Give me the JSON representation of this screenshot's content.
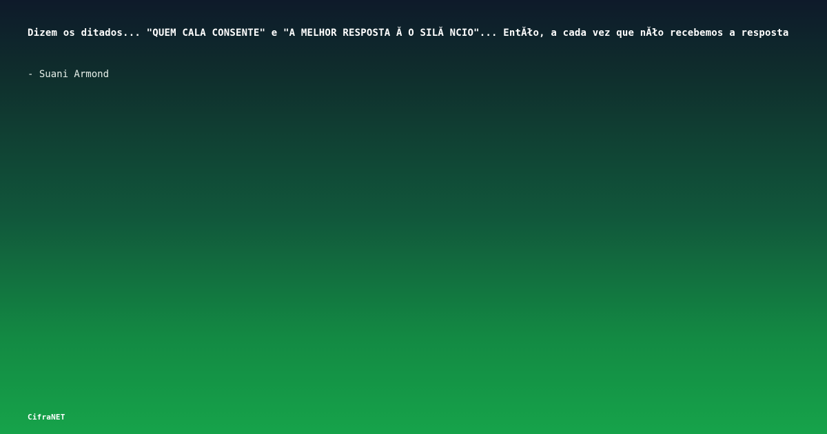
{
  "quote": {
    "text": "Dizem os ditados... \"QUEM CALA CONSENTE\" e \"A MELHOR RESPOSTA Ă  O SILĂ NCIO\"... EntĂło, a cada vez que nĂło recebemos a resposta",
    "author": "- Suani Armond"
  },
  "footer": {
    "brand": "CifraNET"
  }
}
